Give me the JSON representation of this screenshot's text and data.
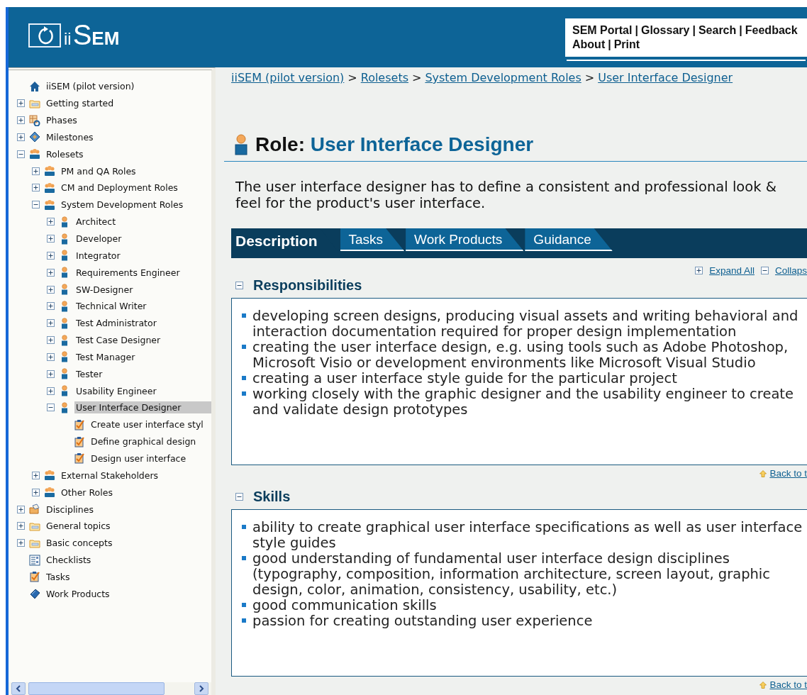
{
  "header": {
    "logo": {
      "prefix": "ii",
      "mark": "S",
      "suffix": "EM"
    },
    "nav": {
      "separator": "|",
      "lines": [
        {
          "links": [
            "SEM Portal",
            "Glossary",
            "Search",
            "Feedback"
          ]
        },
        {
          "links": [
            "About",
            "Print"
          ]
        }
      ]
    }
  },
  "sidebar": {
    "tree": [
      {
        "label": "iiSEM (pilot version)",
        "kind": "home",
        "selected": false
      },
      {
        "label": "Getting started",
        "kind": "folder",
        "expanded": false,
        "selected": false
      },
      {
        "label": "Phases",
        "kind": "phases",
        "expanded": false,
        "selected": false
      },
      {
        "label": "Milestones",
        "kind": "milestone",
        "expanded": false,
        "selected": false
      },
      {
        "label": "Rolesets",
        "kind": "group",
        "expanded": true,
        "selected": false,
        "children": [
          {
            "label": "PM and QA Roles",
            "kind": "group",
            "expanded": false,
            "selected": false
          },
          {
            "label": "CM and Deployment Roles",
            "kind": "group",
            "expanded": false,
            "selected": false
          },
          {
            "label": "System Development Roles",
            "kind": "group",
            "expanded": true,
            "selected": false,
            "children": [
              {
                "label": "Architect",
                "kind": "person",
                "expanded": false,
                "selected": false
              },
              {
                "label": "Developer",
                "kind": "person",
                "expanded": false,
                "selected": false
              },
              {
                "label": "Integrator",
                "kind": "person",
                "expanded": false,
                "selected": false
              },
              {
                "label": "Requirements Engineer",
                "kind": "person",
                "expanded": false,
                "selected": false
              },
              {
                "label": "SW-Designer",
                "kind": "person",
                "expanded": false,
                "selected": false
              },
              {
                "label": "Technical Writer",
                "kind": "person",
                "expanded": false,
                "selected": false
              },
              {
                "label": "Test Administrator",
                "kind": "person",
                "expanded": false,
                "selected": false
              },
              {
                "label": "Test Case Designer",
                "kind": "person",
                "expanded": false,
                "selected": false
              },
              {
                "label": "Test Manager",
                "kind": "person",
                "expanded": false,
                "selected": false
              },
              {
                "label": "Tester",
                "kind": "person",
                "expanded": false,
                "selected": false
              },
              {
                "label": "Usability Engineer",
                "kind": "person",
                "expanded": false,
                "selected": false
              },
              {
                "label": "User Interface Designer",
                "kind": "person",
                "expanded": true,
                "selected": true,
                "children": [
                  {
                    "label": "Create user interface styl",
                    "kind": "task",
                    "selected": false
                  },
                  {
                    "label": "Define graphical design",
                    "kind": "task",
                    "selected": false
                  },
                  {
                    "label": "Design user interface",
                    "kind": "task",
                    "selected": false
                  }
                ]
              }
            ]
          },
          {
            "label": "External Stakeholders",
            "kind": "group",
            "expanded": false,
            "selected": false
          },
          {
            "label": "Other Roles",
            "kind": "group",
            "expanded": false,
            "selected": false
          }
        ]
      },
      {
        "label": "Disciplines",
        "kind": "discipline",
        "expanded": false,
        "selected": false
      },
      {
        "label": "General topics",
        "kind": "folder",
        "expanded": false,
        "selected": false
      },
      {
        "label": "Basic concepts",
        "kind": "folder",
        "expanded": false,
        "selected": false
      },
      {
        "label": "Checklists",
        "kind": "checklist",
        "selected": false
      },
      {
        "label": "Tasks",
        "kind": "task",
        "selected": false
      },
      {
        "label": "Work Products",
        "kind": "book",
        "selected": false
      }
    ]
  },
  "breadcrumb": {
    "separator": ">",
    "items": [
      "iiSEM (pilot version)",
      "Rolesets",
      "System Development Roles",
      "User Interface Designer"
    ]
  },
  "title": {
    "label": "Role:",
    "name": "User Interface Designer"
  },
  "intro": "The user interface designer has to define a consistent and professional look & feel for the product's user interface.",
  "tabs": [
    {
      "label": "Description",
      "selected": true
    },
    {
      "label": "Tasks",
      "selected": false
    },
    {
      "label": "Work Products",
      "selected": false
    },
    {
      "label": "Guidance",
      "selected": false
    }
  ],
  "toolbar": {
    "expand_all": "Expand All",
    "collapse_all": "Collaps"
  },
  "sections": [
    {
      "title": "Responsibilities",
      "expanded": true,
      "back_link": "Back to t",
      "items": [
        "developing screen designs, producing visual assets and writing behavioral and interaction documentation required for proper design implementation",
        "creating the user interface design, e.g. using tools such as Adobe Photoshop, Microsoft Visio or development environments like Microsoft Visual Studio",
        "creating a user interface style guide for the particular project",
        "working closely with the graphic designer and the usability engineer to create and validate design prototypes"
      ]
    },
    {
      "title": "Skills",
      "expanded": true,
      "back_link": "Back to t",
      "items": [
        "ability to create graphical user interface specifications as well as user interface style guides",
        "good understanding of fundamental user interface design disciplines (typography, composition, information architecture, screen layout, graphic design, color, animation, consistency, usability, etc.)",
        "good communication skills",
        "passion for creating outstanding user experience"
      ]
    }
  ]
}
